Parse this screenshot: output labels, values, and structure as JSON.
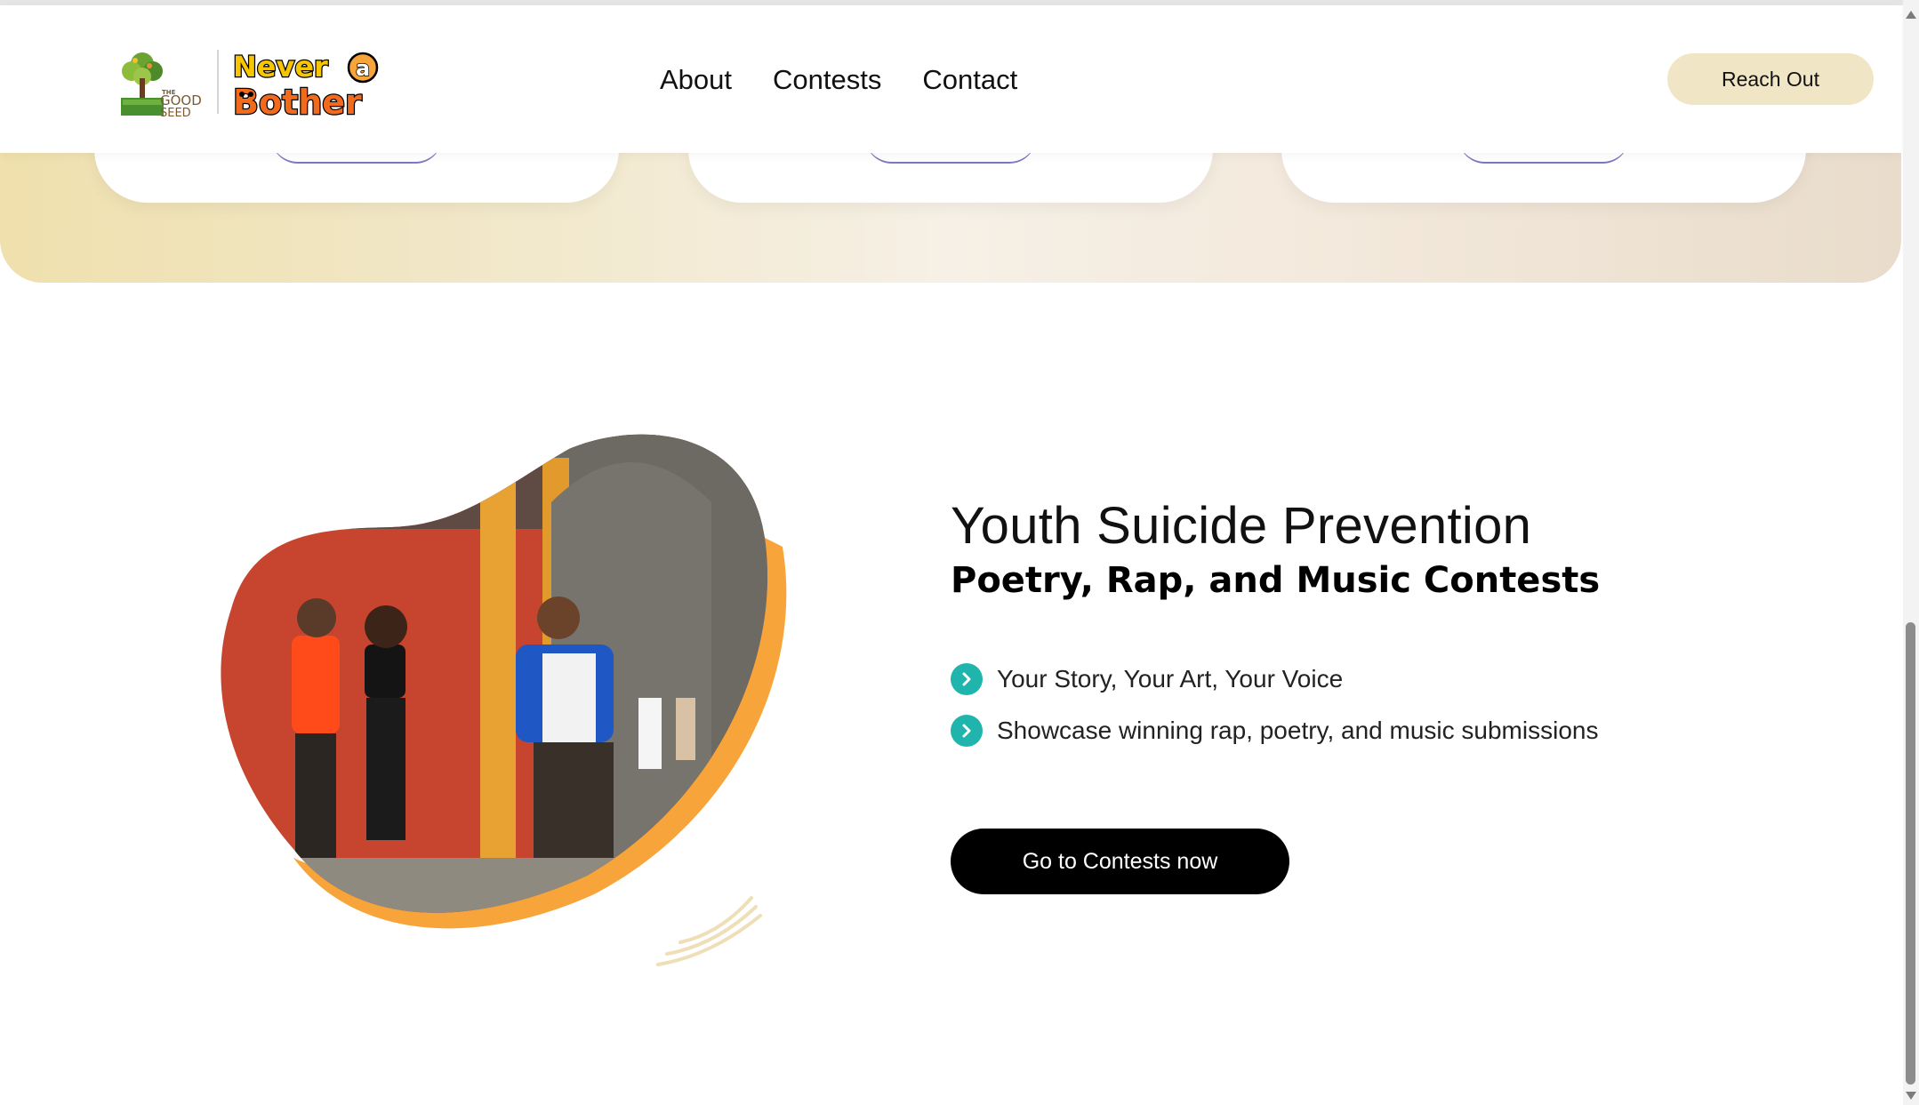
{
  "header": {
    "logo_goodseed_text": [
      "THE",
      "GOOD",
      "SEED"
    ],
    "logo_brand_text": [
      "Never",
      "a",
      "Bother"
    ],
    "nav": [
      {
        "label": "About"
      },
      {
        "label": "Contests"
      },
      {
        "label": "Contact"
      }
    ],
    "reach_out_label": "Reach Out"
  },
  "hero": {
    "title": "Youth Suicide Prevention",
    "subtitle": "Poetry, Rap, and Music Contests",
    "bullets": [
      {
        "icon": "chevron-right-icon",
        "text": "Your Story, Your Art, Your Voice"
      },
      {
        "icon": "chevron-right-icon",
        "text": "Showcase winning rap, poetry, and music submissions"
      }
    ],
    "cta_label": "Go to Contests now"
  },
  "colors": {
    "accent_orange": "#f7a43a",
    "bullet_teal": "#1fb5ad",
    "button_black": "#000000",
    "reach_bg": "#f0e5c5"
  }
}
